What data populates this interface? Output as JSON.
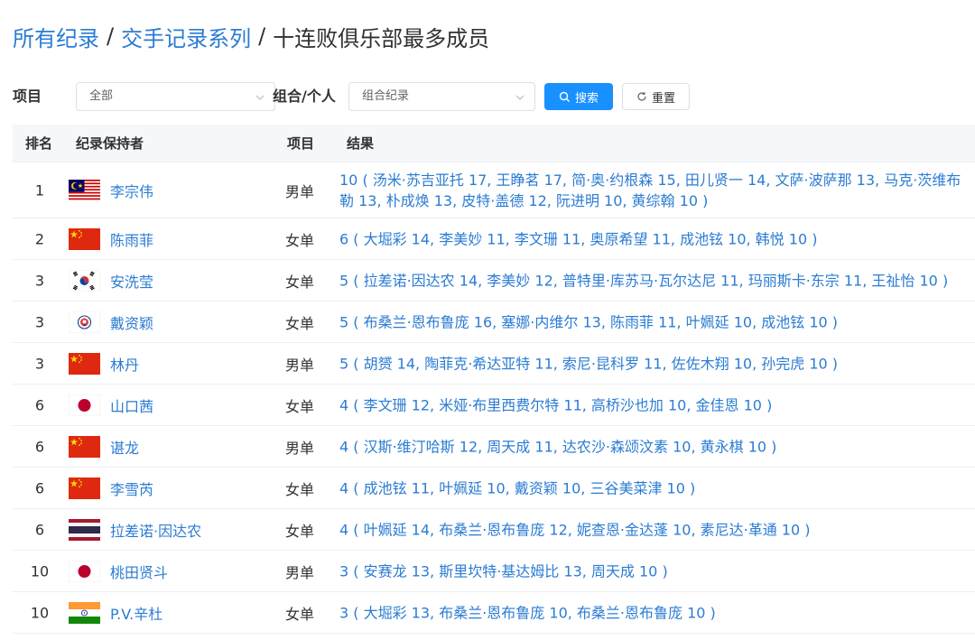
{
  "breadcrumb": {
    "level1": "所有纪录",
    "level2": "交手记录系列",
    "current": "十连败俱乐部最多成员",
    "separator": "/"
  },
  "filters": {
    "event_label": "项目",
    "event_value": "全部",
    "type_label": "组合/个人",
    "type_value": "组合纪录",
    "search_label": "搜索",
    "reset_label": "重置"
  },
  "colors": {
    "link": "#2b7cd3",
    "primary_button": "#1890ff",
    "header_bg": "#f5f7fa"
  },
  "table": {
    "headers": [
      "排名",
      "纪录保持者",
      "项目",
      "结果"
    ],
    "rows": [
      {
        "rank": "1",
        "flag": "malaysia-flag",
        "holder": "李宗伟",
        "event": "男单",
        "result": "10 ( 汤米·苏吉亚托 17, 王睁茗 17, 简·奥·约根森 15, 田儿贤一 14, 文萨·波萨那 13, 马克·茨维布勒 13, 朴成焕 13, 皮特·盖德 12, 阮进明 10, 黄综翰 10 )"
      },
      {
        "rank": "2",
        "flag": "china-flag",
        "holder": "陈雨菲",
        "event": "女单",
        "result": "6 ( 大堀彩 14, 李美妙 11, 李文珊 11, 奥原希望 11, 成池铉 10, 韩悦 10 )"
      },
      {
        "rank": "3",
        "flag": "korea-flag",
        "holder": "安洗莹",
        "event": "女单",
        "result": "5 ( 拉差诺·因达农 14, 李美妙 12, 普特里·库苏马·瓦尔达尼 11, 玛丽斯卡·东宗 11, 王祉怡 10 )"
      },
      {
        "rank": "3",
        "flag": "chinese-taipei-flag",
        "holder": "戴资颖",
        "event": "女单",
        "result": "5 ( 布桑兰·恩布鲁庞 16, 塞娜·内维尔 13, 陈雨菲 11, 叶姵延 10, 成池铉 10 )"
      },
      {
        "rank": "3",
        "flag": "china-flag",
        "holder": "林丹",
        "event": "男单",
        "result": "5 ( 胡赟 14, 陶菲克·希达亚特 11, 索尼·昆科罗 11, 佐佐木翔 10, 孙完虎 10 )"
      },
      {
        "rank": "6",
        "flag": "japan-flag",
        "holder": "山口茜",
        "event": "女单",
        "result": "4 ( 李文珊 12, 米娅·布里西费尔特 11, 高桥沙也加 10, 金佳恩 10 )"
      },
      {
        "rank": "6",
        "flag": "china-flag",
        "holder": "谌龙",
        "event": "男单",
        "result": "4 ( 汉斯·维汀哈斯 12, 周天成 11, 达农沙·森颂汶素 10, 黄永棋 10 )"
      },
      {
        "rank": "6",
        "flag": "china-flag",
        "holder": "李雪芮",
        "event": "女单",
        "result": "4 ( 成池铉 11, 叶姵延 10, 戴资颖 10, 三谷美菜津 10 )"
      },
      {
        "rank": "6",
        "flag": "thailand-flag",
        "holder": "拉差诺·因达农",
        "event": "女单",
        "result": "4 ( 叶姵延 14, 布桑兰·恩布鲁庞 12, 妮查恩·金达蓬 10, 素尼达·革通 10 )"
      },
      {
        "rank": "10",
        "flag": "japan-flag",
        "holder": "桃田贤斗",
        "event": "男单",
        "result": "3 ( 安赛龙 13, 斯里坎特·基达姆比 13, 周天成 10 )"
      },
      {
        "rank": "10",
        "flag": "india-flag",
        "holder": "P.V.辛杜",
        "event": "女单",
        "result": "3 ( 大堀彩 13, 布桑兰·恩布鲁庞 10, 布桑兰·恩布鲁庞 10 )"
      }
    ]
  }
}
